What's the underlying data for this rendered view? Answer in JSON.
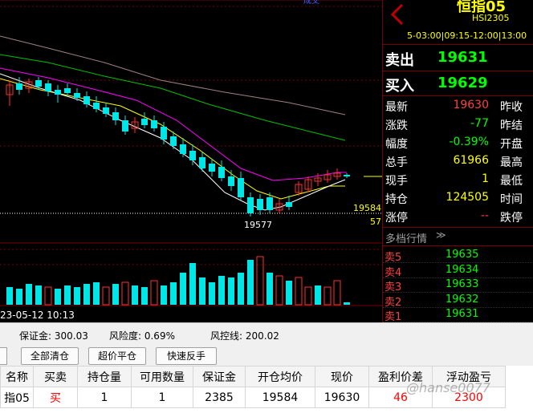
{
  "header": {
    "title": "恒指05",
    "code": "HSI2305",
    "session": "5-03:00|09:15-12:00|13:00",
    "top_label": "成交"
  },
  "quote": {
    "sell_label": "卖出",
    "sell_price": "19631",
    "buy_label": "买入",
    "buy_price": "19629",
    "rows": [
      {
        "label": "最新",
        "value": "19630",
        "label2": "昨收",
        "color": "#ff4040"
      },
      {
        "label": "涨跌",
        "value": "-77",
        "label2": "昨结",
        "color": "#00ff00"
      },
      {
        "label": "幅度",
        "value": "-0.39%",
        "label2": "开盘",
        "color": "#00ff00"
      },
      {
        "label": "总手",
        "value": "61966",
        "label2": "最高",
        "color": "#ffff00"
      },
      {
        "label": "现手",
        "value": "1",
        "label2": "最低",
        "color": "#ffff00"
      },
      {
        "label": "持仓",
        "value": "124505",
        "label2": "时间",
        "color": "#ffff00"
      },
      {
        "label": "涨停",
        "value": "--",
        "label2": "跌停",
        "color": "#ff4040"
      }
    ]
  },
  "orderbook": {
    "title": "多档行情",
    "rows": [
      {
        "label": "卖5",
        "price": "19635"
      },
      {
        "label": "卖4",
        "price": "19634"
      },
      {
        "label": "卖3",
        "price": "19633"
      },
      {
        "label": "卖2",
        "price": "19632"
      },
      {
        "label": "卖1",
        "price": "19631"
      }
    ]
  },
  "chart_labels": {
    "price_line_label": "19584",
    "low_label": "19577",
    "right_axis_label": "57",
    "date_label": "23-05-12 10:13"
  },
  "info": {
    "margin": "保证金: 300.03",
    "risk": "风险度: 0.69%",
    "risk_line": "风控线: 200.02"
  },
  "buttons": {
    "close_all": "全部清仓",
    "super_close": "超价平仓",
    "reverse": "快速反手"
  },
  "table": {
    "headers": [
      "名称",
      "买卖",
      "持仓量",
      "可用数量",
      "保证金",
      "开仓均价",
      "现价",
      "盈利价差",
      "浮动盈亏"
    ],
    "row": [
      "指05",
      "买",
      "1",
      "1",
      "2385",
      "19584",
      "19630",
      "46",
      "2300"
    ]
  },
  "watermark": "@hanse0077",
  "colors": {
    "up": "#ff3030",
    "down": "#00e5e5",
    "ma_white": "#ffffff",
    "ma_yellow": "#ffff00",
    "ma_magenta": "#ff00ff",
    "ma_green": "#00c000",
    "ma_gray": "#a08080",
    "border": "#7a0000"
  }
}
